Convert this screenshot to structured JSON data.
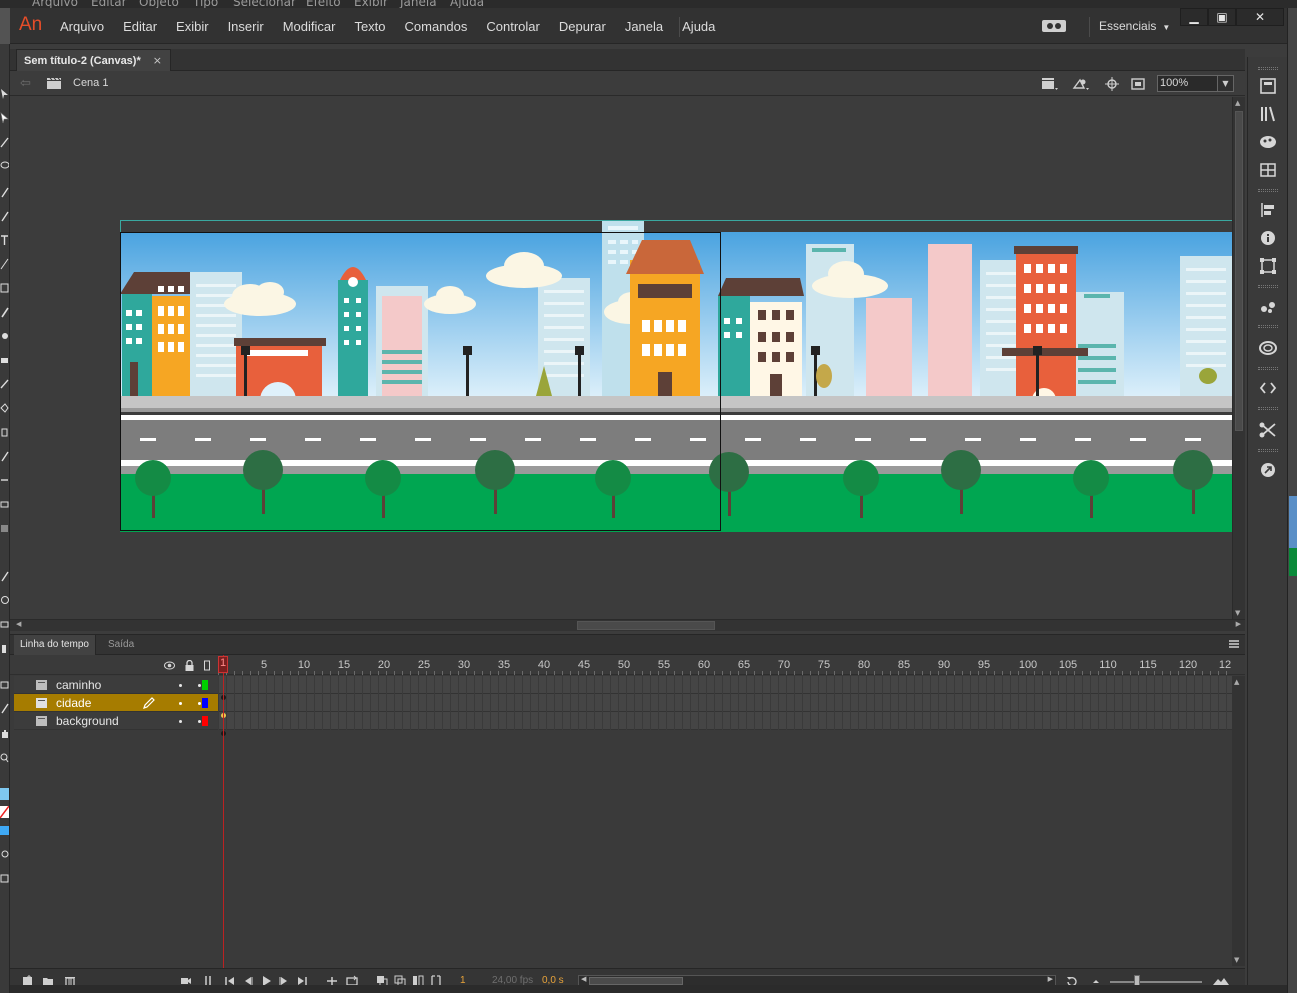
{
  "background_app": {
    "menu": [
      "Arquivo",
      "Editar",
      "Objeto",
      "Tipo",
      "Selecionar",
      "Efeito",
      "Exibir",
      "Janela",
      "Ajuda"
    ]
  },
  "app": {
    "logo": "An",
    "menu": [
      "Arquivo",
      "Editar",
      "Exibir",
      "Inserir",
      "Modificar",
      "Texto",
      "Comandos",
      "Controlar",
      "Depurar",
      "Janela",
      "Ajuda"
    ],
    "workspace": "Essenciais",
    "window_controls": {
      "minimize": "▁",
      "maximize": "▣",
      "close": "✕"
    }
  },
  "document": {
    "tab_label": "Sem título-2 (Canvas)*",
    "close_glyph": "×"
  },
  "editbar": {
    "scene": "Cena 1",
    "zoom": "100%"
  },
  "colors": {
    "logo": "#e64d29",
    "selected_layer": "#a67c00",
    "playhead": "#b22222",
    "timecode": "#e8a33a",
    "sky_top": "#4aa3e0",
    "sky_bottom": "#dff1fb",
    "grass": "#00a651",
    "road": "#7d7d7d"
  },
  "timeline": {
    "tabs": [
      "Linha do tempo",
      "Saída"
    ],
    "ruler": [
      "1",
      "5",
      "10",
      "15",
      "20",
      "25",
      "30",
      "35",
      "40",
      "45",
      "50",
      "55",
      "60",
      "65",
      "70",
      "75",
      "80",
      "85",
      "90",
      "95",
      "100",
      "105",
      "110",
      "115",
      "120",
      "12"
    ],
    "layers": [
      {
        "name": "caminho",
        "color": "#00d000",
        "selected": false
      },
      {
        "name": "cidade",
        "color": "#0000ff",
        "selected": true
      },
      {
        "name": "background",
        "color": "#ff0000",
        "selected": false
      }
    ],
    "playhead_frame": "1",
    "current_frame": "1",
    "fps": "24,00 fps",
    "time": "0,0 s"
  }
}
